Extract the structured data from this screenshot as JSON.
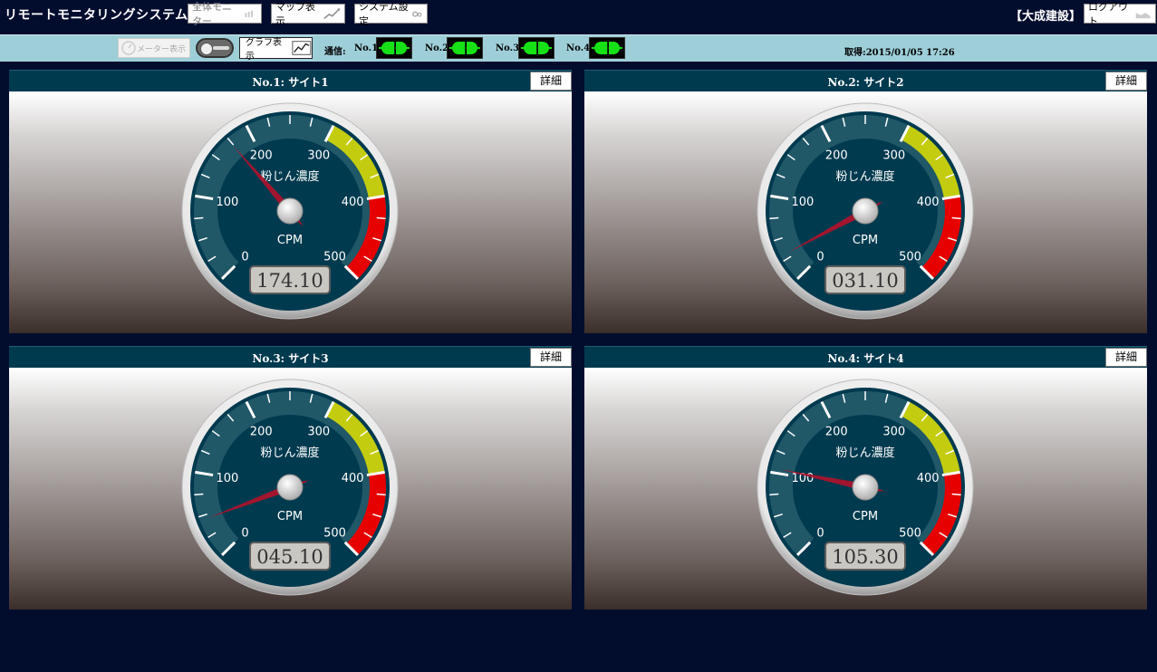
{
  "app": {
    "title": "リモートモニタリングシステム",
    "company": "【大成建設】"
  },
  "toolbar": {
    "overall_monitor": "全体モニター",
    "map_view": "マップ表示",
    "system_settings": "システム設定",
    "logout": "ログアウト"
  },
  "subbar": {
    "meter_view": "メーター表示",
    "graph_view": "グラフ表示",
    "comm_label": "通信:",
    "nodes": [
      "No.1",
      "No.2",
      "No.3",
      "No.4"
    ],
    "acquired": "取得:2015/01/05 17:26"
  },
  "colors": {
    "panel_header": "#003a4f",
    "gauge_face": "#003a4f",
    "yellow_zone": "#c4cc10",
    "red_zone": "#e60000",
    "plug_green": "#17e017"
  },
  "gauge_common": {
    "label": "粉じん濃度",
    "unit": "CPM",
    "ticks": [
      "0",
      "100",
      "200",
      "300",
      "400",
      "500"
    ],
    "min": 0,
    "max": 500
  },
  "panels": [
    {
      "title": "No.1: サイト1",
      "detail": "詳細",
      "value": 174.1,
      "display": "174.10"
    },
    {
      "title": "No.2: サイト2",
      "detail": "詳細",
      "value": 31.1,
      "display": "031.10"
    },
    {
      "title": "No.3: サイト3",
      "detail": "詳細",
      "value": 45.1,
      "display": "045.10"
    },
    {
      "title": "No.4: サイト4",
      "detail": "詳細",
      "value": 105.3,
      "display": "105.30"
    }
  ]
}
